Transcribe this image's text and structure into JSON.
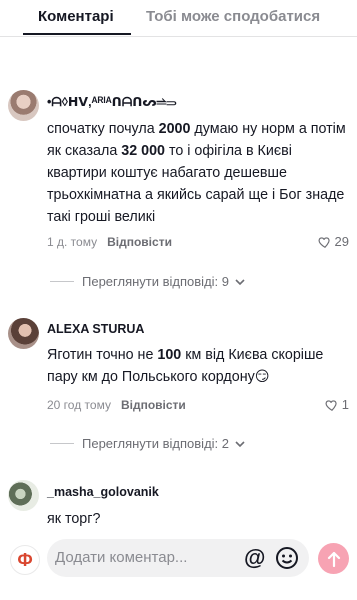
{
  "tabs": {
    "comments": "Коментарі",
    "you_may_like": "Тобі може сподобатися"
  },
  "comments": [
    {
      "author": "•ᗩ◊ᕼᐯ,ᴬᴿᴵᴬᑎᗩᑎᔕ⥬⥰",
      "text_parts": [
        "спочатку почула ",
        "2000",
        " думаю ну норм а потім як сказала ",
        "32 000",
        " то і офігіла в Києві квартири коштує набагато дешевше трьохкімнатна а якийсь сарай ще і Бог знаде такі гроші великі"
      ],
      "time": "1 д. тому",
      "reply_label": "Відповісти",
      "likes": "29",
      "view_replies": "Переглянути відповіді: 9"
    },
    {
      "author": "ALEXA STURUA",
      "text_parts": [
        "Яготин точно не ",
        "100",
        " км від Києва скоріше пару км до Польського кордону😏"
      ],
      "time": "20 год тому",
      "reply_label": "Відповісти",
      "likes": "1",
      "view_replies": "Переглянути відповіді: 2"
    },
    {
      "author": "_masha_golovanik",
      "text": "як торг?"
    }
  ],
  "input": {
    "placeholder": "Додати коментар...",
    "at_symbol": "@",
    "my_avatar_letter": "Ф"
  },
  "colors": {
    "accent_send": "#f7a3b3",
    "text_primary": "#161823",
    "text_secondary": "#8a8b91"
  }
}
